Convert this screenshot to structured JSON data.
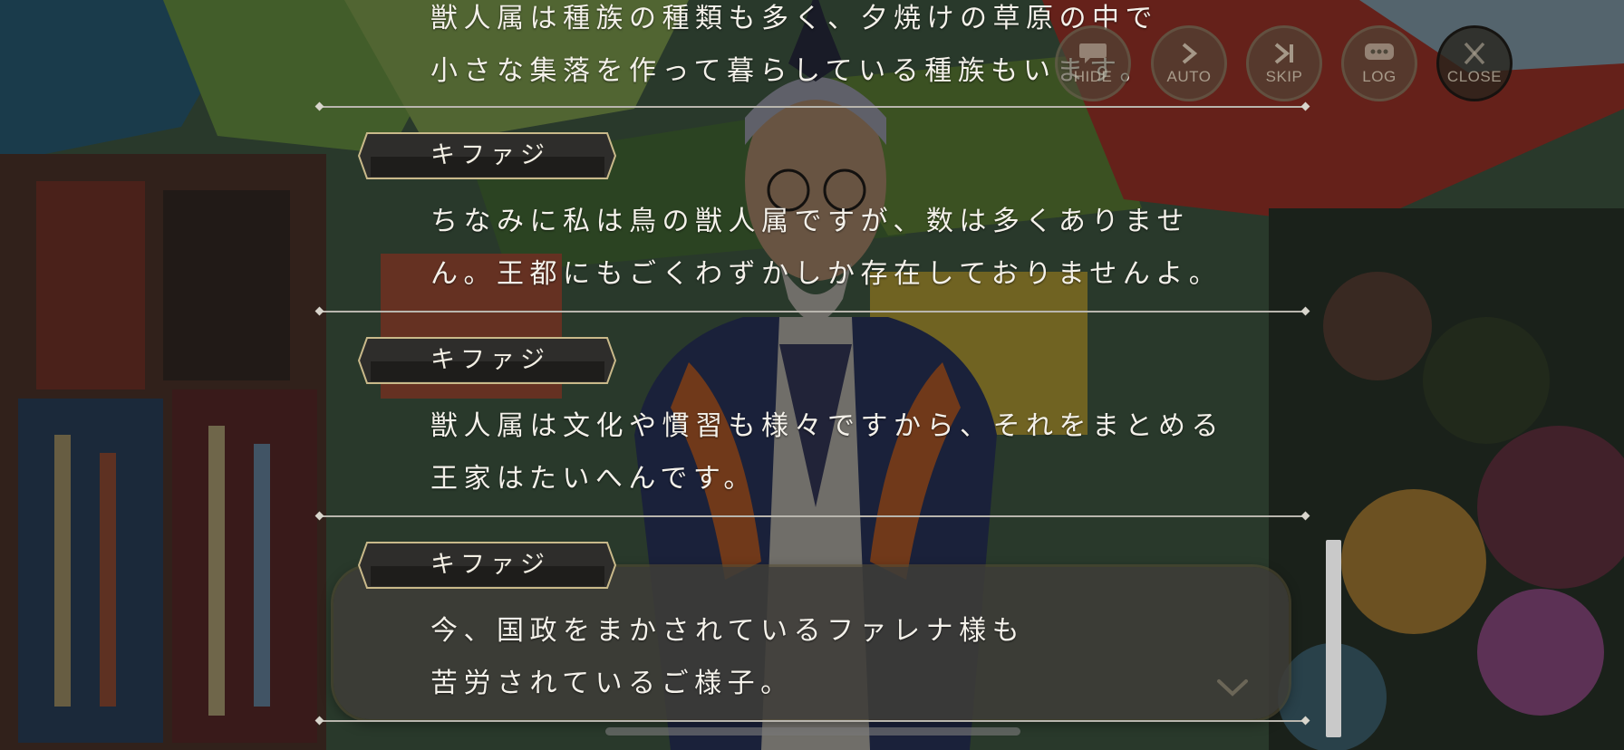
{
  "character": "キファジ",
  "log": {
    "entries": [
      {
        "speaker": "",
        "lines": [
          "獣人属は種族の種類も多く、夕焼けの草原の中で",
          "小さな集落を作って暮らしている種族もいます。"
        ]
      },
      {
        "speaker": "キファジ",
        "lines": [
          "ちなみに私は鳥の獣人属ですが、数は多くありませ",
          "ん。王都にもごくわずかしか存在しておりませんよ。"
        ]
      },
      {
        "speaker": "キファジ",
        "lines": [
          "獣人属は文化や慣習も様々ですから、それをまとめる",
          "王家はたいへんです。"
        ]
      },
      {
        "speaker": "キファジ",
        "lines": [
          "今、国政をまかされているファレナ様も",
          "苦労されているご様子。"
        ]
      }
    ]
  },
  "controls": {
    "hide": {
      "label": "HIDE",
      "icon": "speech-bubble-icon"
    },
    "auto": {
      "label": "AUTO",
      "icon": "play-chevron-icon"
    },
    "skip": {
      "label": "SKIP",
      "icon": "skip-forward-icon"
    },
    "log": {
      "label": "LOG",
      "icon": "chat-log-icon"
    },
    "close": {
      "label": "CLOSE",
      "icon": "close-x-icon"
    }
  },
  "colors": {
    "text": "#f4f1ea",
    "nameplate_border": "#c9b98a",
    "divider": "#b9b6ae",
    "highlight_box": "#3e3c38"
  }
}
